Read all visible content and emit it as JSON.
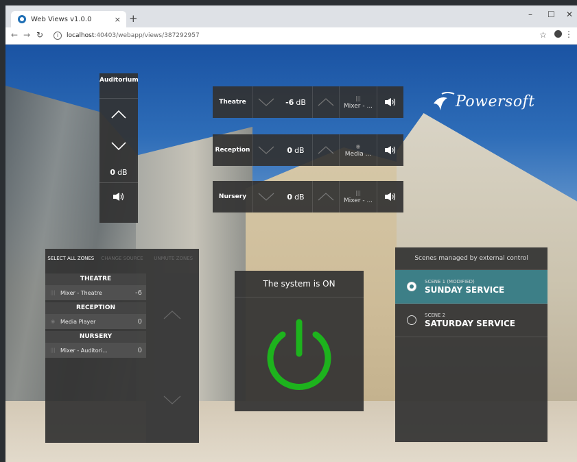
{
  "browser": {
    "tab_title": "Web Views v1.0.0",
    "tab_close": "×",
    "new_tab": "+",
    "url_host": "localhost",
    "url_path": ":40403/webapp/views/387292957",
    "win_minimize": "–",
    "win_maximize": "☐",
    "win_close": "✕"
  },
  "vertical_zone": {
    "name": "Auditorium",
    "level_value": "0",
    "level_unit": "dB"
  },
  "zones": [
    {
      "name": "Theatre",
      "level_value": "-6",
      "level_unit": "dB",
      "source": "Mixer - ..."
    },
    {
      "name": "Reception",
      "level_value": "0",
      "level_unit": "dB",
      "source": "Media ..."
    },
    {
      "name": "Nursery",
      "level_value": "0",
      "level_unit": "dB",
      "source": "Mixer - ..."
    }
  ],
  "logo": {
    "text": "Powersoft"
  },
  "zones_panel": {
    "select_all": "SELECT ALL ZONES",
    "change_source": "CHANGE SOURCE",
    "unmute_zones": "UNMUTE ZONES",
    "groups": [
      {
        "name": "THEATRE",
        "item": "Mixer - Theatre",
        "value": "-6"
      },
      {
        "name": "RECEPTION",
        "item": "Media Player",
        "value": "0"
      },
      {
        "name": "NURSERY",
        "item": "Mixer - Auditori...",
        "value": "0"
      }
    ]
  },
  "power": {
    "status": "The system is ON",
    "color": "#1db31d"
  },
  "scenes": {
    "header": "Scenes managed by external control",
    "items": [
      {
        "sub": "SCENE 1 (MODIFIED)",
        "name": "SUNDAY SERVICE",
        "active": true
      },
      {
        "sub": "SCENE 2",
        "name": "SATURDAY SERVICE",
        "active": false
      }
    ]
  },
  "colors": {
    "accent": "#3d7f87",
    "panel": "#323232"
  }
}
